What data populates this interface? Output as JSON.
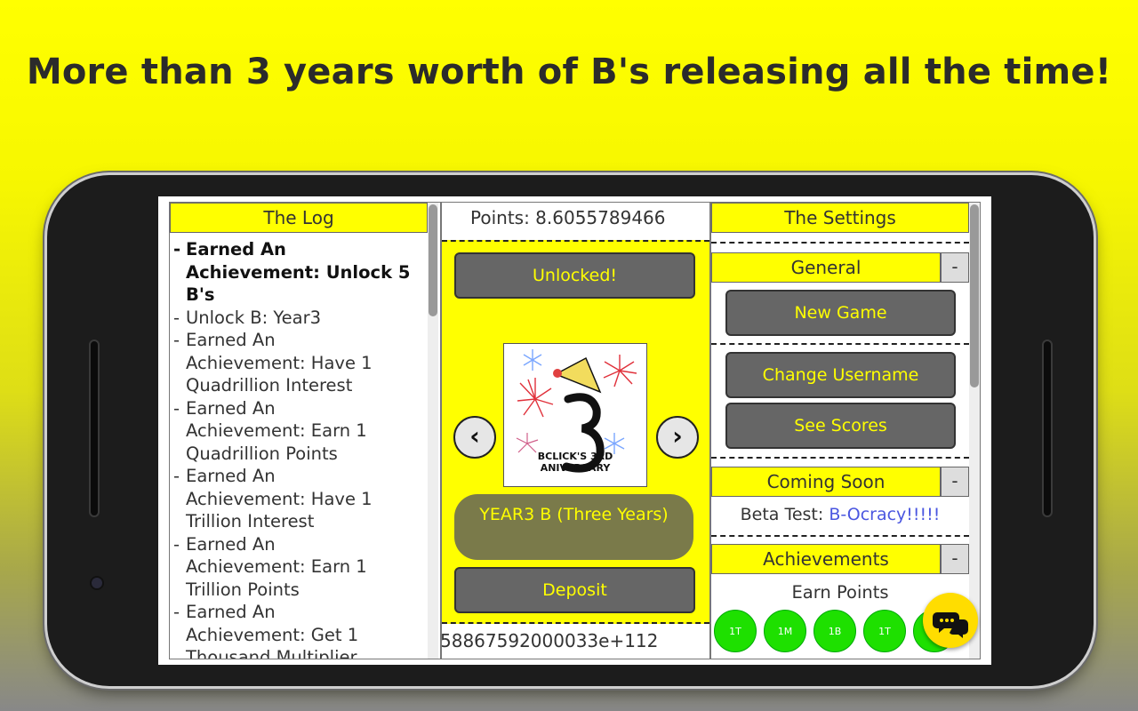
{
  "headline": "More than 3 years worth of B's releasing all the time!",
  "log": {
    "title": "The Log",
    "entries": [
      {
        "bold": true,
        "lines": [
          "Earned An",
          "Achievement: Unlock 5",
          "B's"
        ]
      },
      {
        "bold": false,
        "lines": [
          "Unlock B: Year3"
        ]
      },
      {
        "bold": false,
        "lines": [
          "Earned An",
          "Achievement: Have 1",
          "Quadrillion Interest"
        ]
      },
      {
        "bold": false,
        "lines": [
          "Earned An",
          "Achievement: Earn 1",
          "Quadrillion Points"
        ]
      },
      {
        "bold": false,
        "lines": [
          "Earned An",
          "Achievement: Have 1",
          "Trillion Interest"
        ]
      },
      {
        "bold": false,
        "lines": [
          "Earned An",
          "Achievement: Earn 1",
          "Trillion Points"
        ]
      },
      {
        "bold": false,
        "lines": [
          "Earned An",
          "Achievement: Get 1",
          "Thousand Multiplier"
        ]
      }
    ]
  },
  "center": {
    "points_label": "Points: 8.6055789466",
    "unlocked_label": "Unlocked!",
    "card": {
      "caption_line1": "BCLICK'S 3RD",
      "caption_line2": "ANIVERSARY",
      "big_digit": "3"
    },
    "prev_icon": "chevron-left-icon",
    "next_icon": "chevron-right-icon",
    "b_name": "YEAR3 B (Three Years)",
    "deposit_label": "Deposit",
    "points_value": "58867592000033e+112"
  },
  "settings": {
    "title": "The Settings",
    "general": {
      "label": "General",
      "toggle": "-"
    },
    "new_game": "New Game",
    "change_username": "Change Username",
    "see_scores": "See Scores",
    "coming_soon": {
      "label": "Coming Soon",
      "toggle": "-"
    },
    "beta_prefix": "Beta Test: ",
    "beta_link": "B-Ocracy!!!!!",
    "achievements": {
      "label": "Achievements",
      "toggle": "-"
    },
    "earn_points": "Earn Points",
    "badges": [
      "1T",
      "1M",
      "1B",
      "1T"
    ]
  },
  "fab_icon": "chat-icon",
  "colors": {
    "accent_yellow": "#ffff00",
    "button_gray": "#666666",
    "badge_green": "#1ee000",
    "link_blue": "#4a56e0"
  }
}
